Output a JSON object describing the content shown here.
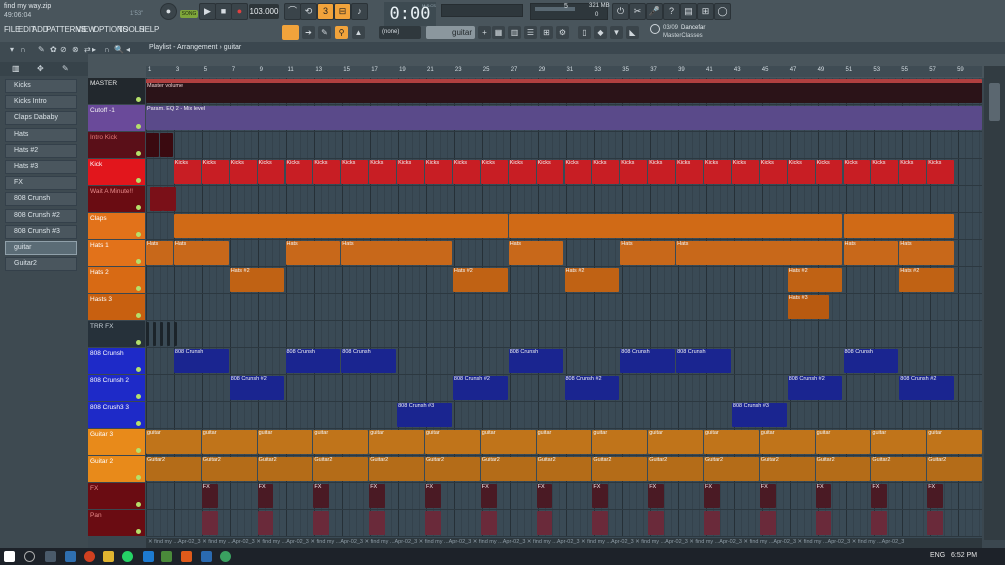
{
  "window": {
    "project_name": "find my way.zip",
    "project_time": "49:06:04",
    "song_position": "1'53\""
  },
  "transport": {
    "mode": "SONG",
    "tempo": "103.000",
    "time": "0:00",
    "time_unit": "M:S:CS",
    "play_icon": "play-icon",
    "stop_icon": "stop-icon",
    "record_icon": "record-icon"
  },
  "cpu": {
    "cores": "5",
    "memory": "321 MB",
    "polyphony": "0"
  },
  "menu": [
    "FILE",
    "EDIT",
    "ADD",
    "PATTERNS",
    "VIEW",
    "OPTIONS",
    "TOOLS",
    "HELP"
  ],
  "news": {
    "date": "03/09",
    "title": "Dancefar",
    "subtitle": "MasterClasses"
  },
  "pattern_selector": {
    "value": "(none)"
  },
  "instrument_selector": {
    "value": "guitar"
  },
  "playlist": {
    "title": "Playlist - Arrangement",
    "separator": "›",
    "channel": "guitar"
  },
  "browser": {
    "items": [
      "Kicks",
      "Kicks Intro",
      "Claps Dababy",
      "Hats",
      "Hats #2",
      "Hats #3",
      "FX",
      "808 Crunsh",
      "808 Crunsh #2",
      "808 Crunsh #3",
      "guitar",
      "Guitar2"
    ],
    "selected": "guitar"
  },
  "ruler": [
    "1",
    "3",
    "5",
    "7",
    "9",
    "11",
    "13",
    "15",
    "17",
    "19",
    "21",
    "23",
    "25",
    "27",
    "29",
    "31",
    "33",
    "35",
    "37",
    "39",
    "41",
    "43",
    "45",
    "47",
    "49",
    "51",
    "53",
    "55",
    "57",
    "59",
    "61"
  ],
  "tracks": [
    {
      "name": "MASTER",
      "color": "#22282d",
      "text": "#e8e8e8",
      "h": 27
    },
    {
      "name": "Cutoff -1",
      "color": "#6a4a9a",
      "text": "#f2f2f2",
      "h": 27
    },
    {
      "name": "Intro Kick",
      "color": "#5a0f18",
      "text": "#e57a7a",
      "h": 27
    },
    {
      "name": "Kick",
      "color": "#e2161c",
      "text": "#ffffff",
      "h": 27
    },
    {
      "name": "Wait A Minute!!",
      "color": "#6a0c12",
      "text": "#e88a8a",
      "h": 27
    },
    {
      "name": "Claps",
      "color": "#e2721a",
      "text": "#ffffff",
      "h": 27
    },
    {
      "name": "Hats 1",
      "color": "#e2721a",
      "text": "#ffffff",
      "h": 27
    },
    {
      "name": "Hats 2",
      "color": "#d86a14",
      "text": "#ffffff",
      "h": 27
    },
    {
      "name": "Hasts 3",
      "color": "#c86010",
      "text": "#ffffff",
      "h": 27
    },
    {
      "name": "TRR FX",
      "color": "#26313a",
      "text": "#c9d2d8",
      "h": 27
    },
    {
      "name": "808 Crunsh",
      "color": "#1e2ac8",
      "text": "#ffffff",
      "h": 27
    },
    {
      "name": "808 Crunsh 2",
      "color": "#1e2ac8",
      "text": "#ffffff",
      "h": 27
    },
    {
      "name": "808 Crush3 3",
      "color": "#1e2ac8",
      "text": "#ffffff",
      "h": 27
    },
    {
      "name": "Guitar 3",
      "color": "#e88a1a",
      "text": "#ffffff",
      "h": 27
    },
    {
      "name": "Guitar 2",
      "color": "#e88a1a",
      "text": "#ffffff",
      "h": 27
    },
    {
      "name": "FX",
      "color": "#6a0c12",
      "text": "#e88a8a",
      "h": 27
    },
    {
      "name": "Pan",
      "color": "#6a0c12",
      "text": "#e88a8a",
      "h": 27
    }
  ],
  "clips": {
    "master": "Master volume",
    "automation": "Param. EQ 2 - Mix level",
    "kick": "Kicks",
    "hats1": "Hats",
    "hats2": "Hats #2",
    "hats3": "Hats #3",
    "c808": "808 Crunsh",
    "c808b": "808 Crunsh #2",
    "c808c": "808 Crunsh #3",
    "guitar": "guitar",
    "guitar2": "Guitar2",
    "fx": "FX"
  },
  "hscroll_text": "find my ...Apr-02_3",
  "taskbar": {
    "language": "ENG",
    "time": "6:52 PM"
  }
}
